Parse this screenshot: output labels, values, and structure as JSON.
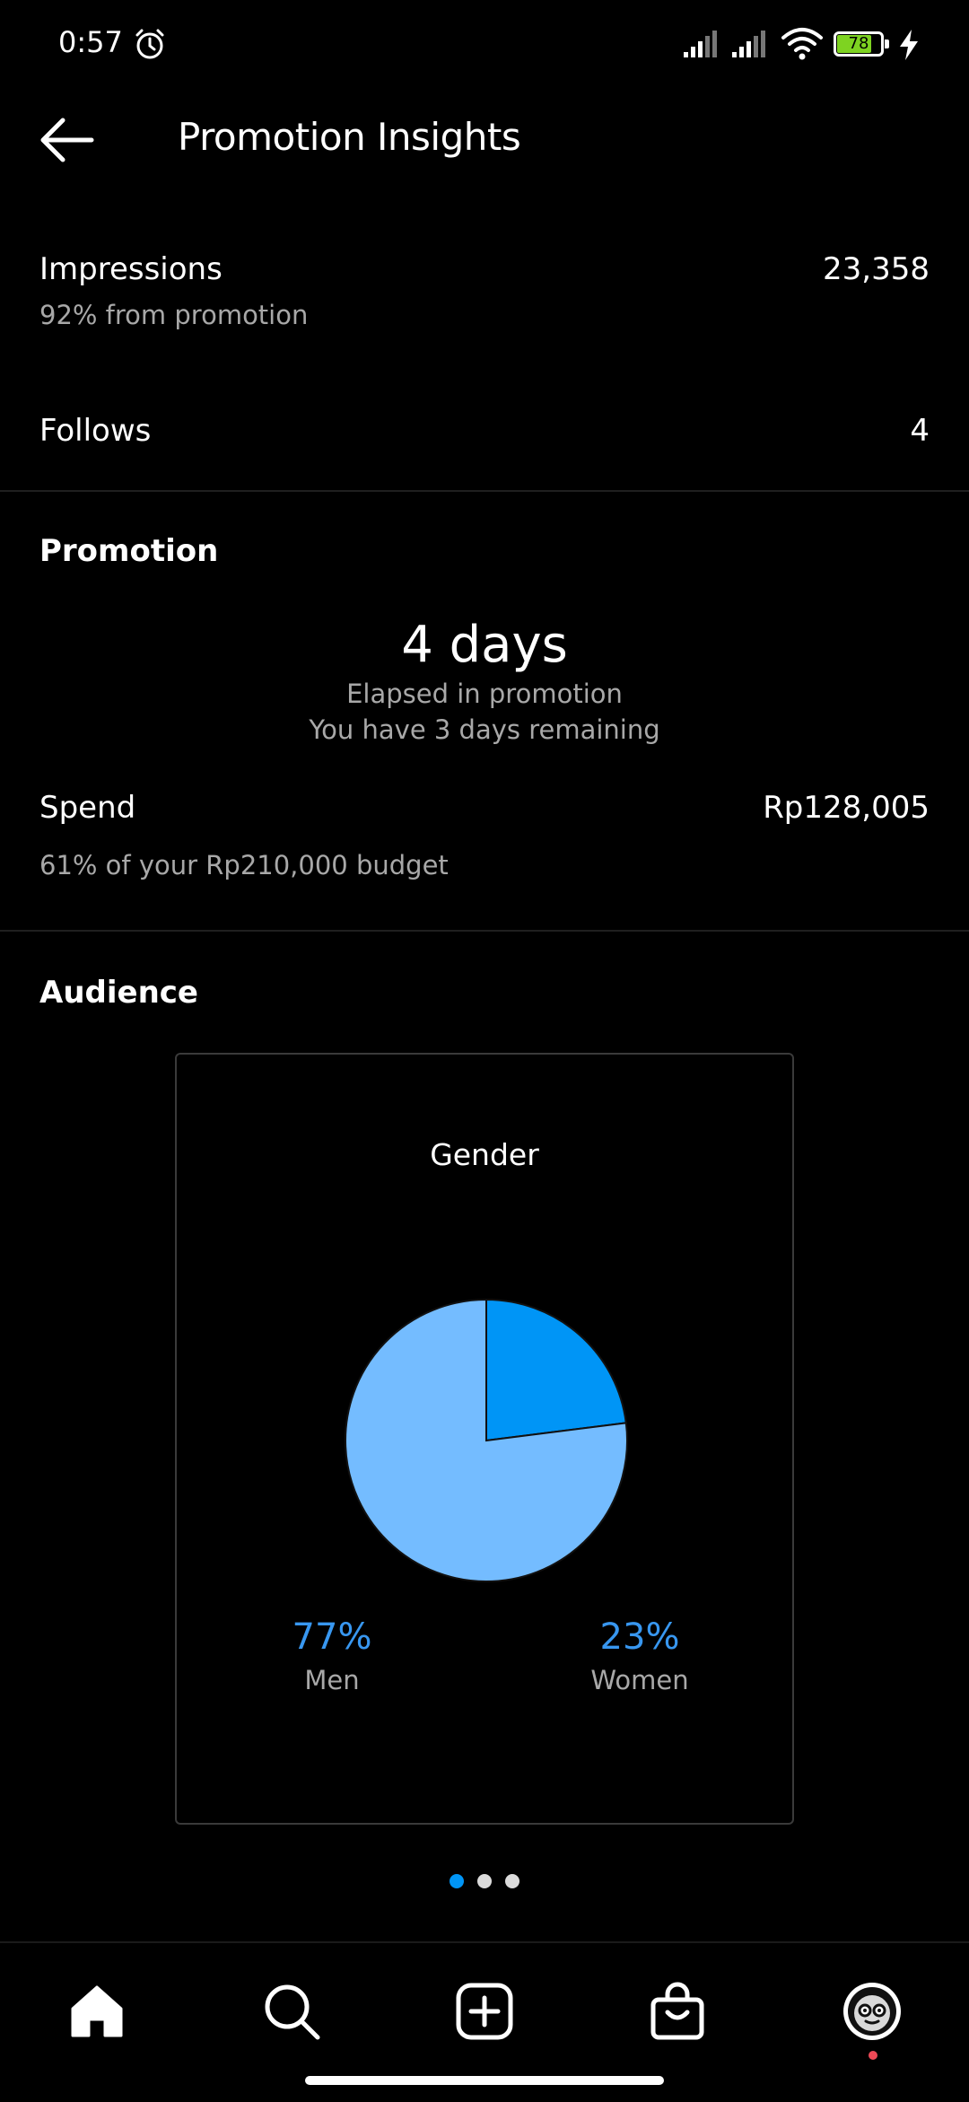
{
  "status_bar": {
    "time": "0:57",
    "battery_level": "78",
    "icons": [
      "alarm-icon",
      "signal-icon",
      "signal-icon",
      "wifi-icon",
      "battery-icon",
      "charging-bolt-icon"
    ],
    "battery_color": "#7ed321"
  },
  "header": {
    "title": "Promotion Insights",
    "back_icon": "back-arrow-icon"
  },
  "stats": {
    "impressions": {
      "label": "Impressions",
      "value": "23,358",
      "sub": "92% from promotion"
    },
    "follows": {
      "label": "Follows",
      "value": "4"
    }
  },
  "promotion": {
    "title": "Promotion",
    "days": "4 days",
    "elapsed_text": "Elapsed in promotion",
    "remaining_text": "You have 3 days remaining",
    "spend_label": "Spend",
    "spend_value": "Rp128,005",
    "budget_text": "61% of your Rp210,000 budget"
  },
  "audience": {
    "title": "Audience",
    "card_title": "Gender",
    "men_pct": "77%",
    "men_label": "Men",
    "women_pct": "23%",
    "women_label": "Women",
    "pager": {
      "count": 3,
      "active": 0
    }
  },
  "chart_data": {
    "type": "pie",
    "title": "Gender",
    "categories": [
      "Men",
      "Women"
    ],
    "values": [
      77,
      23
    ],
    "colors": [
      "#74bcff",
      "#0095f6"
    ]
  },
  "colors": {
    "background": "#000000",
    "accent": "#3897f0",
    "secondary_text": "#a8a8a8",
    "active_dot": "#0095f6",
    "inactive_dot": "#dbdbdb",
    "notification": "#ed4956"
  },
  "bottom_nav": {
    "items": [
      "home-icon",
      "search-icon",
      "create-post-icon",
      "shop-icon",
      "profile-avatar"
    ]
  }
}
